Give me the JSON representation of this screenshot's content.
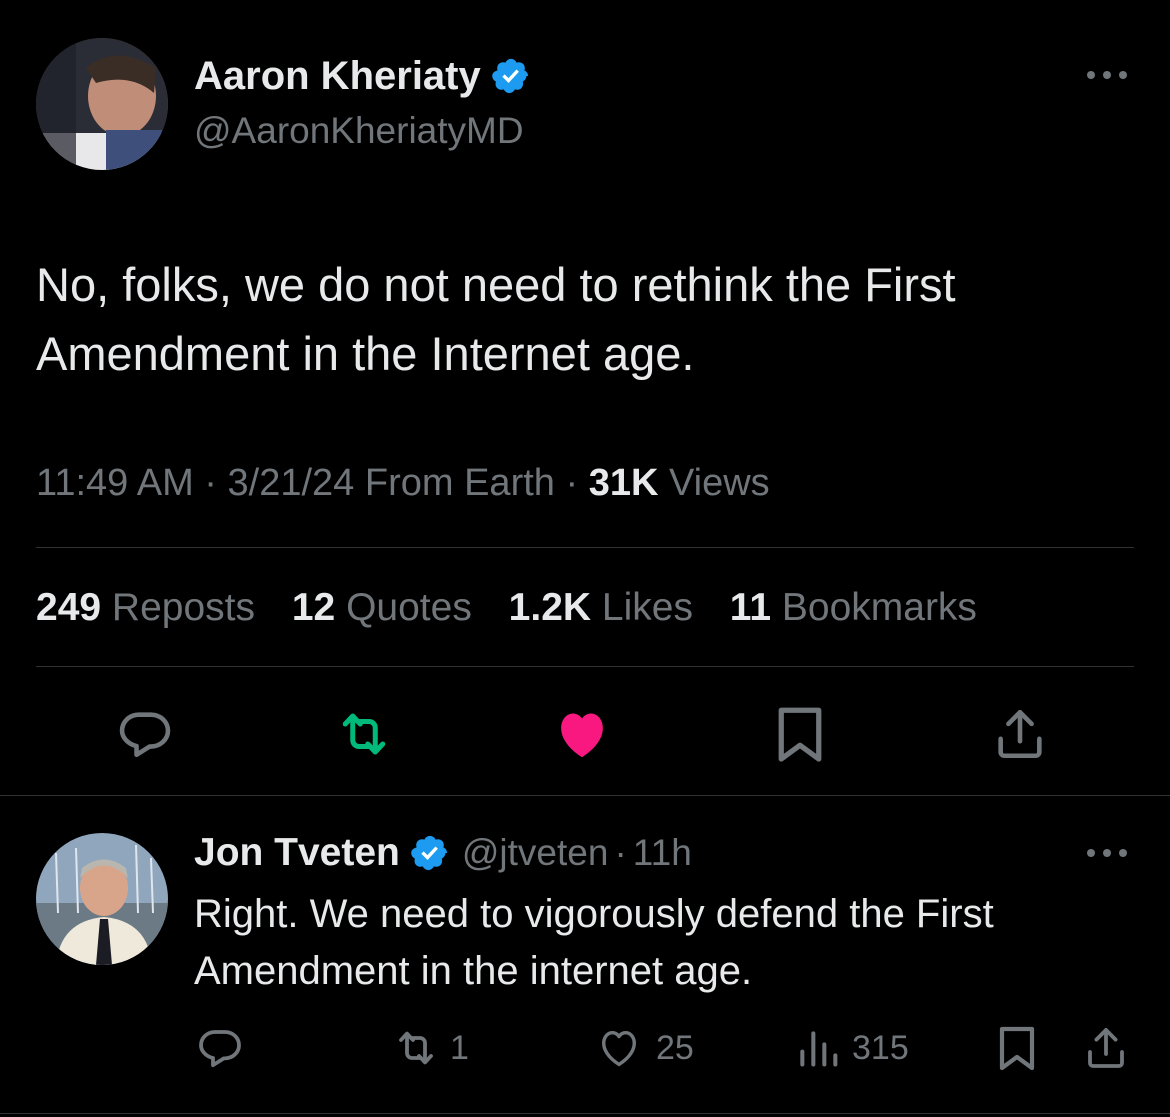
{
  "main_post": {
    "author_name": "Aaron Kheriaty",
    "author_handle": "@AaronKheriatyMD",
    "text_line1": "No, folks, we do not need to rethink the First",
    "text_line2": "Amendment in the Internet age.",
    "time": "11:49 AM",
    "sep1": "·",
    "date": "3/21/24",
    "source": "From Earth",
    "sep2": "·",
    "views_count": "31K",
    "views_label": "Views",
    "stats": [
      {
        "count": "249",
        "label": "Reposts"
      },
      {
        "count": "12",
        "label": "Quotes"
      },
      {
        "count": "1.2K",
        "label": "Likes"
      },
      {
        "count": "11",
        "label": "Bookmarks"
      }
    ],
    "liked": true,
    "reposted": true
  },
  "reply": {
    "author_name": "Jon Tveten",
    "author_handle": "@jtveten",
    "sep": "·",
    "age": "11h",
    "text_line1": "Right. We need to vigorously defend the First",
    "text_line2": "Amendment in the internet age.",
    "reposts": "1",
    "likes": "25",
    "views": "315"
  },
  "colors": {
    "background": "#000000",
    "text": "#e7e9ea",
    "muted": "#71767b",
    "verified": "#1d9bf0",
    "like_active": "#f91880",
    "repost_active": "#00ba7c",
    "divider": "#2f3336"
  },
  "icons": [
    "verified-badge-icon",
    "more-icon",
    "reply-icon",
    "repost-icon",
    "like-icon",
    "bookmark-icon",
    "share-icon",
    "views-icon"
  ]
}
